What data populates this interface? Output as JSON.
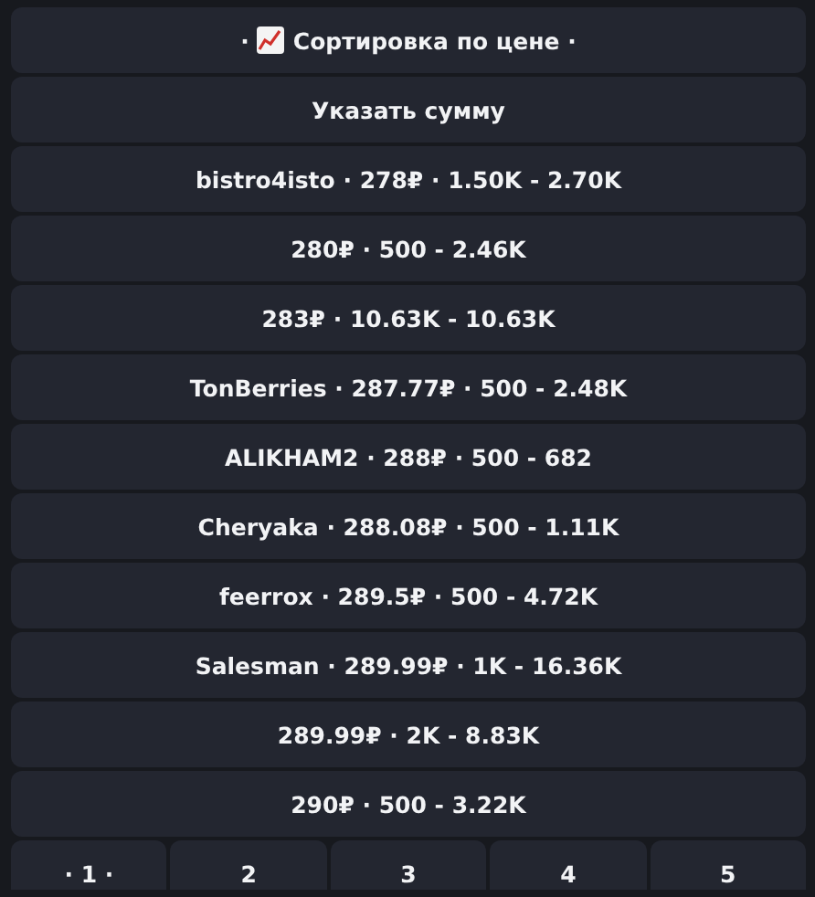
{
  "sort_button": {
    "prefix": "·",
    "label": "Сортировка по цене ·"
  },
  "amount_button": {
    "label": "Указать сумму"
  },
  "offers": [
    {
      "label": "bistro4isto · 278₽ · 1.50K - 2.70K"
    },
    {
      "label": "280₽ · 500 - 2.46K"
    },
    {
      "label": "283₽ · 10.63K - 10.63K"
    },
    {
      "label": "TonBerries · 287.77₽ · 500 - 2.48K"
    },
    {
      "label": "ALIKHAM2 · 288₽ · 500 - 682"
    },
    {
      "label": "Cheryaka · 288.08₽ · 500 - 1.11K"
    },
    {
      "label": "feerrox · 289.5₽ · 500 - 4.72K"
    },
    {
      "label": "Salesman · 289.99₽ · 1K - 16.36K"
    },
    {
      "label": "289.99₽ · 2K - 8.83K"
    },
    {
      "label": "290₽ · 500 - 3.22K"
    }
  ],
  "pages": [
    "· 1 ·",
    "2",
    "3",
    "4",
    "5"
  ]
}
